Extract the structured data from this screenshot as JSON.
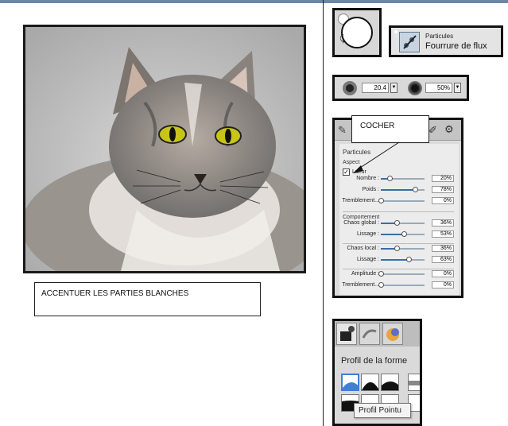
{
  "note": {
    "text": "ACCENTUER LES PARTIES  BLANCHES"
  },
  "callout": {
    "text": "COCHER"
  },
  "preset": {
    "category": "Particules",
    "name": "Fourrure de flux"
  },
  "brush": {
    "size": "20.4",
    "opacity": "50%"
  },
  "particles": {
    "title": "Particules",
    "aspect_label": "Aspect",
    "glow_label": "Lueur",
    "glow_checked": true,
    "behavior_label": "Comportement",
    "sliders": [
      {
        "label": "Nombre :",
        "value": "20%",
        "fraction": 0.2
      },
      {
        "label": "Poids :",
        "value": "78%",
        "fraction": 0.78
      },
      {
        "label": "Tremblement...",
        "value": "0%",
        "fraction": 0.0
      },
      {
        "label": "Chaos global :",
        "value": "36%",
        "fraction": 0.36
      },
      {
        "label": "Lissage :",
        "value": "53%",
        "fraction": 0.53
      },
      {
        "label": "Chaos local :",
        "value": "36%",
        "fraction": 0.36
      },
      {
        "label": "Lissage :",
        "value": "63%",
        "fraction": 0.63
      },
      {
        "label": "Amplitude :",
        "value": "0%",
        "fraction": 0.0
      },
      {
        "label": "Tremblement...",
        "value": "0%",
        "fraction": 0.0
      }
    ]
  },
  "profile": {
    "title": "Profil de la forme",
    "tooltip": "Profil Pointu"
  },
  "colors": {
    "accent": "#3a6ea5",
    "topbar": "#6b86a8",
    "selected_shape": "#3f7fd6"
  }
}
